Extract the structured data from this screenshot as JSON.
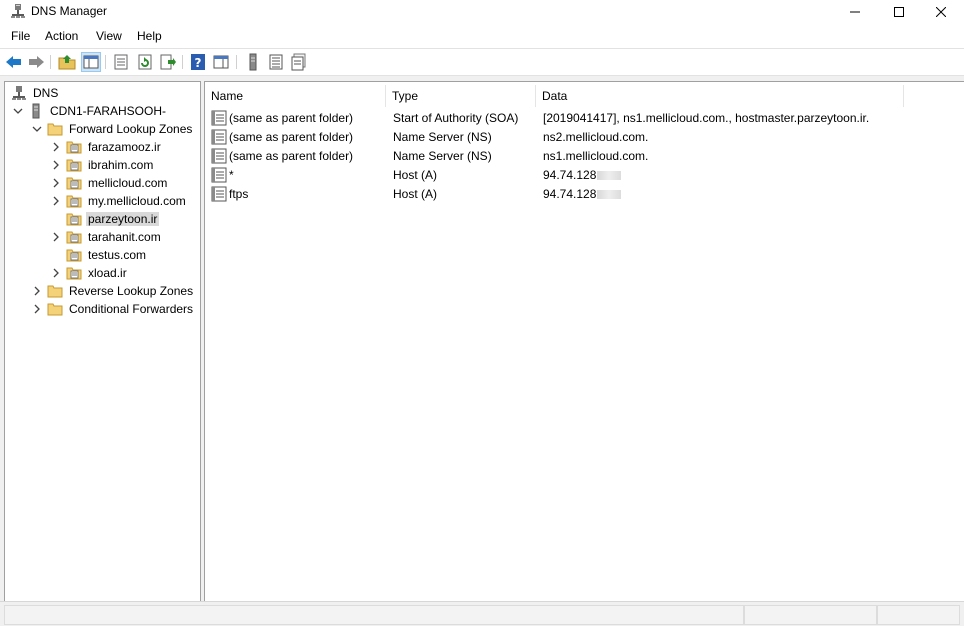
{
  "window": {
    "title": "DNS Manager",
    "icon": "dns-server-icon",
    "controls": [
      "minimize-icon",
      "maximize-icon",
      "close-icon"
    ]
  },
  "menu": {
    "items": [
      "File",
      "Action",
      "View",
      "Help"
    ]
  },
  "toolbar": {
    "buttons": [
      "back-arrow-icon",
      "forward-arrow-icon",
      "up-folder-icon",
      "show-hide-tree-icon",
      "properties-icon",
      "refresh-icon",
      "export-list-icon",
      "help-icon",
      "action-pane-icon",
      "server-icon",
      "zone-list-icon",
      "record-icon"
    ],
    "colors": {
      "arrow_blue": "#1e78c8",
      "help_blue": "#2a5db0"
    }
  },
  "tree": {
    "root": "DNS",
    "server": "CDN1-FARAHSOOH-",
    "forward_zones": "Forward Lookup Zones",
    "zones": [
      "farazamooz.ir",
      "ibrahim.com",
      "mellicloud.com",
      "my.mellicloud.com",
      "parzeytoon.ir",
      "tarahanit.com",
      "testus.com",
      "xload.ir"
    ],
    "selected_zone": "parzeytoon.ir",
    "reverse_zones": "Reverse Lookup Zones",
    "conditional_forwarders": "Conditional Forwarders"
  },
  "list": {
    "columns": [
      "Name",
      "Type",
      "Data"
    ],
    "records": [
      {
        "name": "(same as parent folder)",
        "type": "Start of Authority (SOA)",
        "data": "[2019041417], ns1.mellicloud.com., hostmaster.parzeytoon.ir."
      },
      {
        "name": "(same as parent folder)",
        "type": "Name Server (NS)",
        "data": "ns2.mellicloud.com."
      },
      {
        "name": "(same as parent folder)",
        "type": "Name Server (NS)",
        "data": "ns1.mellicloud.com."
      },
      {
        "name": "*",
        "type": "Host (A)",
        "data": "94.74.128"
      },
      {
        "name": "ftps",
        "type": "Host (A)",
        "data": "94.74.128"
      }
    ]
  }
}
